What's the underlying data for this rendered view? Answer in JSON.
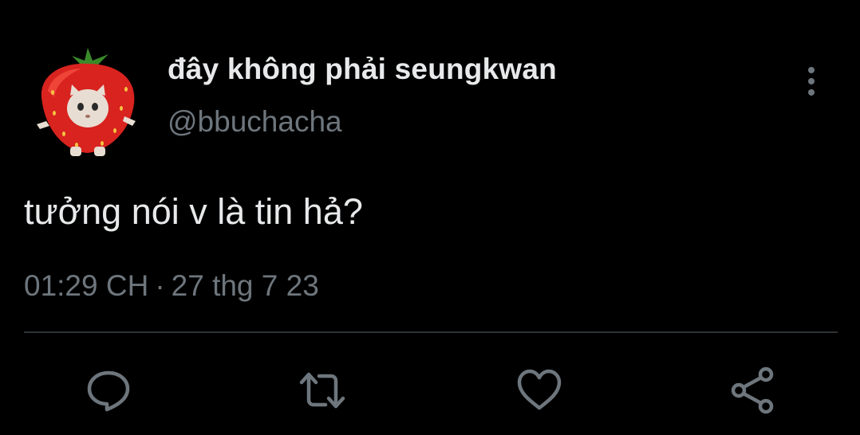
{
  "tweet": {
    "display_name": "đây không phải seungkwan",
    "handle": "@bbuchacha",
    "text": "tưởng nói v là tin hả?",
    "time": "01:29 CH",
    "separator": "·",
    "date": "27 thg 7 23"
  },
  "icons": {
    "avatar": "strawberry-cat-avatar",
    "more": "more-vertical-icon",
    "reply": "reply-icon",
    "retweet": "retweet-icon",
    "like": "heart-icon",
    "share": "share-icon"
  },
  "colors": {
    "background": "#000000",
    "primary_text": "#e7e9ea",
    "secondary_text": "#6e767d",
    "divider": "#2f3336",
    "icon": "#6e767d"
  }
}
